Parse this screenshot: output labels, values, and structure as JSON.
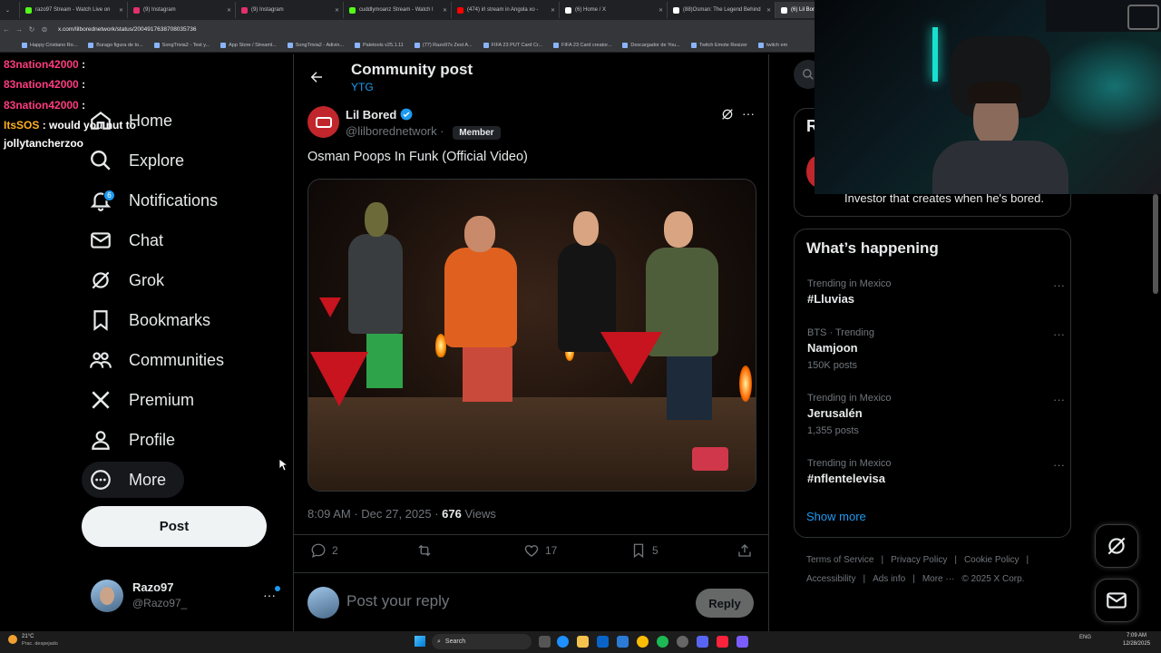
{
  "browser": {
    "tabs": [
      {
        "label": "razo97 Stream - Watch Live on",
        "color": "#53fc18"
      },
      {
        "label": "(9) Instagram",
        "color": "#e1306c"
      },
      {
        "label": "(9) Instagram",
        "color": "#e1306c"
      },
      {
        "label": "cuddlymoanz Stream - Watch l",
        "color": "#53fc18"
      },
      {
        "label": "(474) irl stream in Angola xo -",
        "color": "#ff0000"
      },
      {
        "label": "(6) Home / X",
        "color": "#ffffff"
      },
      {
        "label": "(88)Osman: The Legend Behind",
        "color": "#ffffff"
      },
      {
        "label": "(6) Lil Bored",
        "color": "#ffffff"
      }
    ],
    "url": "x.com/lilborednetwork/status/2004917638708035736",
    "bookmarks": [
      "Happy Cristiano Ro...",
      "Burago figura de to...",
      "SongTrivia2 - Test y...",
      "App Store / Streaml...",
      "SongTrivia2 - Adivin...",
      "Paletools v25.1.11",
      "(77) Razo97s Zest A...",
      "FIFA 23 PUT Card Cr...",
      "FIFA 23 Card creator...",
      "Descargador de You...",
      "Twitch Emote Resizer",
      "twitch em"
    ]
  },
  "chat_overlay": [
    {
      "user": "83nation42000",
      "text": ":"
    },
    {
      "user": "83nation42000",
      "text": ":"
    },
    {
      "user": "83nation42000",
      "text": ":"
    },
    {
      "user": "ItsSOS",
      "text": ": would you nut to"
    },
    {
      "user": "",
      "text": "jollytancherzoo"
    }
  ],
  "sidebar": {
    "items": [
      {
        "label": "Home",
        "icon": "home-icon"
      },
      {
        "label": "Explore",
        "icon": "search-icon"
      },
      {
        "label": "Notifications",
        "icon": "bell-icon",
        "badge": "6"
      },
      {
        "label": "Chat",
        "icon": "mail-icon"
      },
      {
        "label": "Grok",
        "icon": "grok-icon"
      },
      {
        "label": "Bookmarks",
        "icon": "bookmark-icon"
      },
      {
        "label": "Communities",
        "icon": "communities-icon"
      },
      {
        "label": "Premium",
        "icon": "x-logo-icon"
      },
      {
        "label": "Profile",
        "icon": "person-icon"
      },
      {
        "label": "More",
        "icon": "more-circle-icon"
      }
    ],
    "post_label": "Post",
    "account": {
      "name": "Razo97",
      "handle": "@Razo97_"
    }
  },
  "header": {
    "title": "Community post",
    "subtitle": "YTG"
  },
  "post": {
    "author_name": "Lil Bored",
    "author_handle": "@lilborednetwork",
    "member_badge": "Member",
    "text": "Osman Poops In Funk (Official Video)",
    "time": "8:09 AM · Dec 27, 2025 · ",
    "views_count": "676",
    "views_label": " Views",
    "replies": "2",
    "likes": "17",
    "bookmarks": "5",
    "reply_placeholder": "Post your reply",
    "reply_button": "Reply"
  },
  "right": {
    "bio_fragment": "Investor that creates when he's bored.",
    "heading": "What’s happening",
    "trends": [
      {
        "context": "Trending in Mexico",
        "name": "#Lluvias",
        "count": ""
      },
      {
        "context": "BTS · Trending",
        "name": "Namjoon",
        "count": "150K posts"
      },
      {
        "context": "Trending in Mexico",
        "name": "Jerusalén",
        "count": "1,355 posts"
      },
      {
        "context": "Trending in Mexico",
        "name": "#nflentelevisa",
        "count": ""
      }
    ],
    "show_more": "Show more",
    "footer_row1": [
      "Terms of Service",
      "|",
      "Privacy Policy",
      "|",
      "Cookie Policy",
      "|"
    ],
    "footer_row2": [
      "Accessibility",
      "|",
      "Ads info",
      "|",
      "More ···",
      "© 2025 X Corp."
    ],
    "partial_letter": "R"
  },
  "taskbar": {
    "weather_temp": "21°C",
    "weather_text": "Prac. despejado",
    "search": "Search",
    "lang": "ENG",
    "time": "7:09 AM",
    "date": "12/28/2025"
  },
  "colors": {
    "accent": "#1d9bf0",
    "text": "#e7e9ea",
    "muted": "#71767b",
    "border": "#2f3336"
  }
}
